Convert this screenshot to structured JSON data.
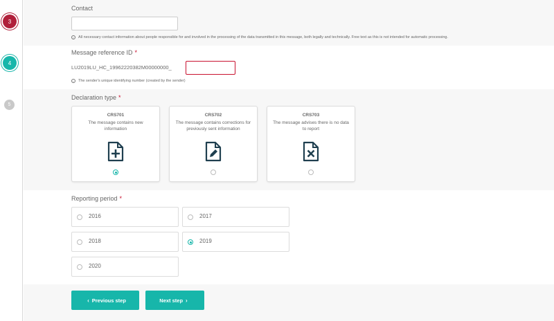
{
  "stepper": {
    "steps": [
      {
        "number": "3",
        "state": "error",
        "color": "#b01f3a"
      },
      {
        "number": "4",
        "state": "active",
        "color": "#17b6aa"
      },
      {
        "number": "5",
        "state": "pending",
        "color": "#c9c9c9"
      }
    ]
  },
  "contact": {
    "label": "Contact",
    "value": "",
    "hint": "All necessary contact information about people responsible for and involved in the processing of the data transmitted in this message, both legally and technically. Free text as this is not intended for automatic processing."
  },
  "message_reference": {
    "label": "Message reference ID",
    "required_mark": "*",
    "prefix": "LU2019LU_HC_19962220382M00000000_",
    "value": "",
    "hint": "The sender's unique identifying number (created by the sender)"
  },
  "declaration_type": {
    "label": "Declaration type",
    "required_mark": "*",
    "options": [
      {
        "code": "CRS701",
        "description": "The message contains new information",
        "icon": "file-plus-icon",
        "selected": true
      },
      {
        "code": "CRS702",
        "description": "The message contains corrections for previously sent information",
        "icon": "file-edit-icon",
        "selected": false
      },
      {
        "code": "CRS703",
        "description": "The message advises there is no data to report",
        "icon": "file-x-icon",
        "selected": false
      }
    ]
  },
  "reporting_period": {
    "label": "Reporting period",
    "required_mark": "*",
    "options": [
      {
        "year": "2016",
        "selected": false
      },
      {
        "year": "2017",
        "selected": false
      },
      {
        "year": "2018",
        "selected": false
      },
      {
        "year": "2019",
        "selected": true
      },
      {
        "year": "2020",
        "selected": false
      }
    ]
  },
  "buttons": {
    "previous": "Previous step",
    "next": "Next step"
  },
  "colors": {
    "accent": "#17b6aa",
    "error": "#c8102e",
    "icon_dark": "#1f3f4f"
  }
}
